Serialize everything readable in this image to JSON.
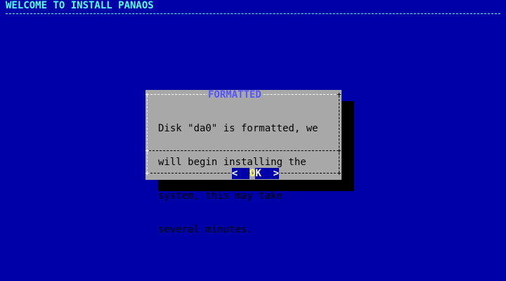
{
  "backtitle": "WELCOME TO INSTALL PANAOS",
  "dialog": {
    "title": "FORMATTED",
    "message_lines": [
      "Disk \"da0\" is formatted, we",
      "will begin installing the",
      "system, this may take",
      "several minutes."
    ],
    "ok_button": {
      "left_bracket": "<",
      "hotkey": "O",
      "rest": "K",
      "right_bracket": ">"
    }
  },
  "colors": {
    "background": "#0000a8",
    "dialog": "#a8a8a8",
    "title": "#5555ff",
    "backtitle": "#55ffff",
    "button_hotkey": "#ffff55"
  }
}
